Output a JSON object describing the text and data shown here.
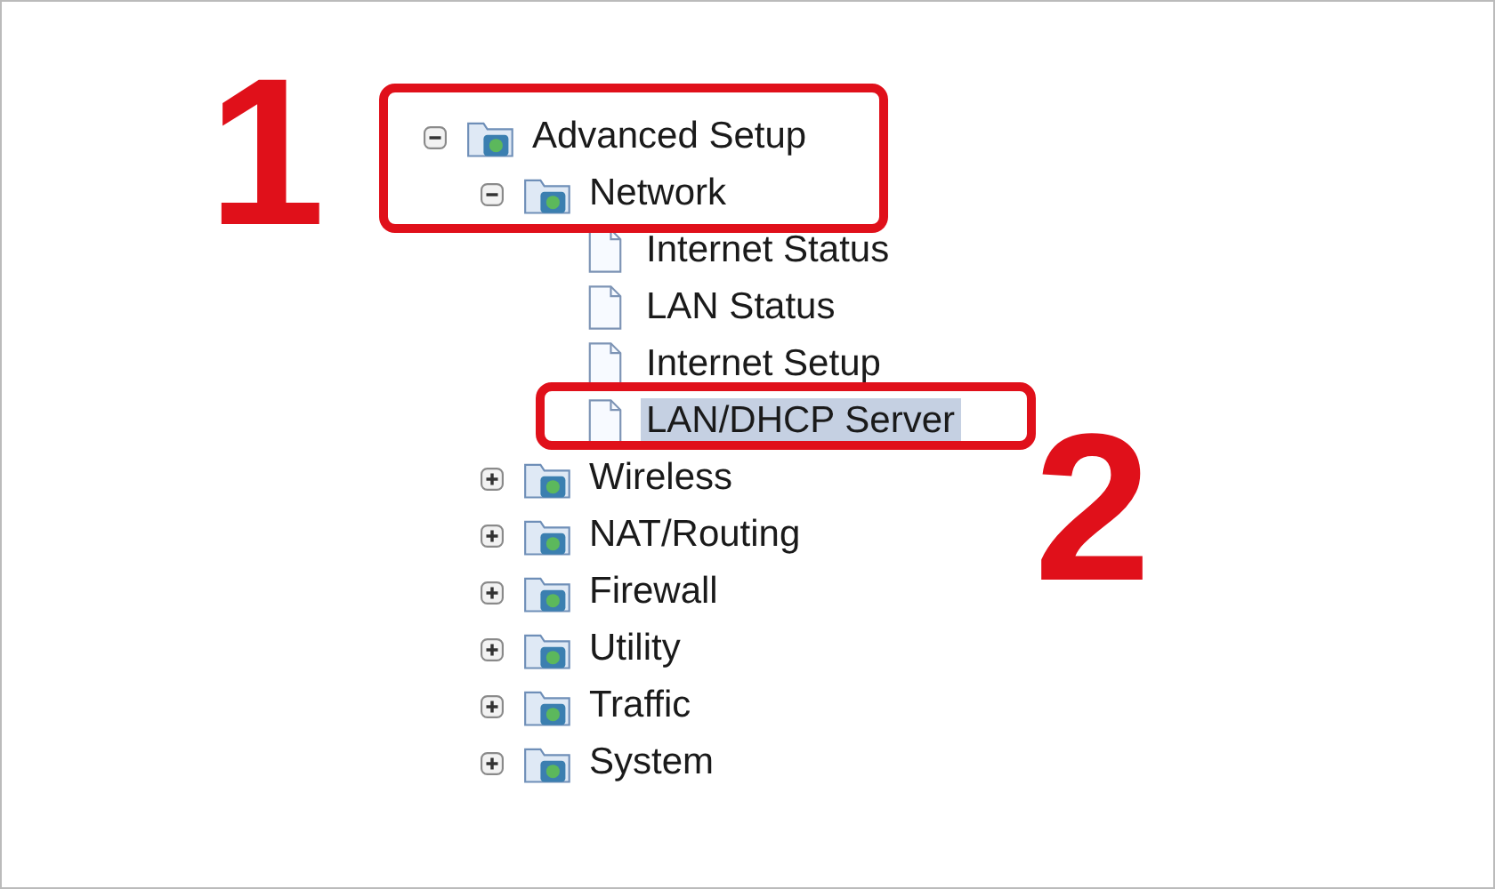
{
  "tree": [
    {
      "label": "Advanced Setup",
      "kind": "folder",
      "expanded": true,
      "children": [
        {
          "label": "Network",
          "kind": "folder",
          "expanded": true,
          "children": [
            {
              "label": "Internet Status",
              "kind": "page",
              "selected": false
            },
            {
              "label": "LAN Status",
              "kind": "page",
              "selected": false
            },
            {
              "label": "Internet Setup",
              "kind": "page",
              "selected": false
            },
            {
              "label": "LAN/DHCP Server",
              "kind": "page",
              "selected": true
            }
          ]
        },
        {
          "label": "Wireless",
          "kind": "folder",
          "expanded": false
        },
        {
          "label": "NAT/Routing",
          "kind": "folder",
          "expanded": false
        },
        {
          "label": "Firewall",
          "kind": "folder",
          "expanded": false
        },
        {
          "label": "Utility",
          "kind": "folder",
          "expanded": false
        },
        {
          "label": "Traffic",
          "kind": "folder",
          "expanded": false
        },
        {
          "label": "System",
          "kind": "folder",
          "expanded": false
        }
      ]
    }
  ],
  "annotations": [
    {
      "number": "1"
    },
    {
      "number": "2"
    }
  ]
}
